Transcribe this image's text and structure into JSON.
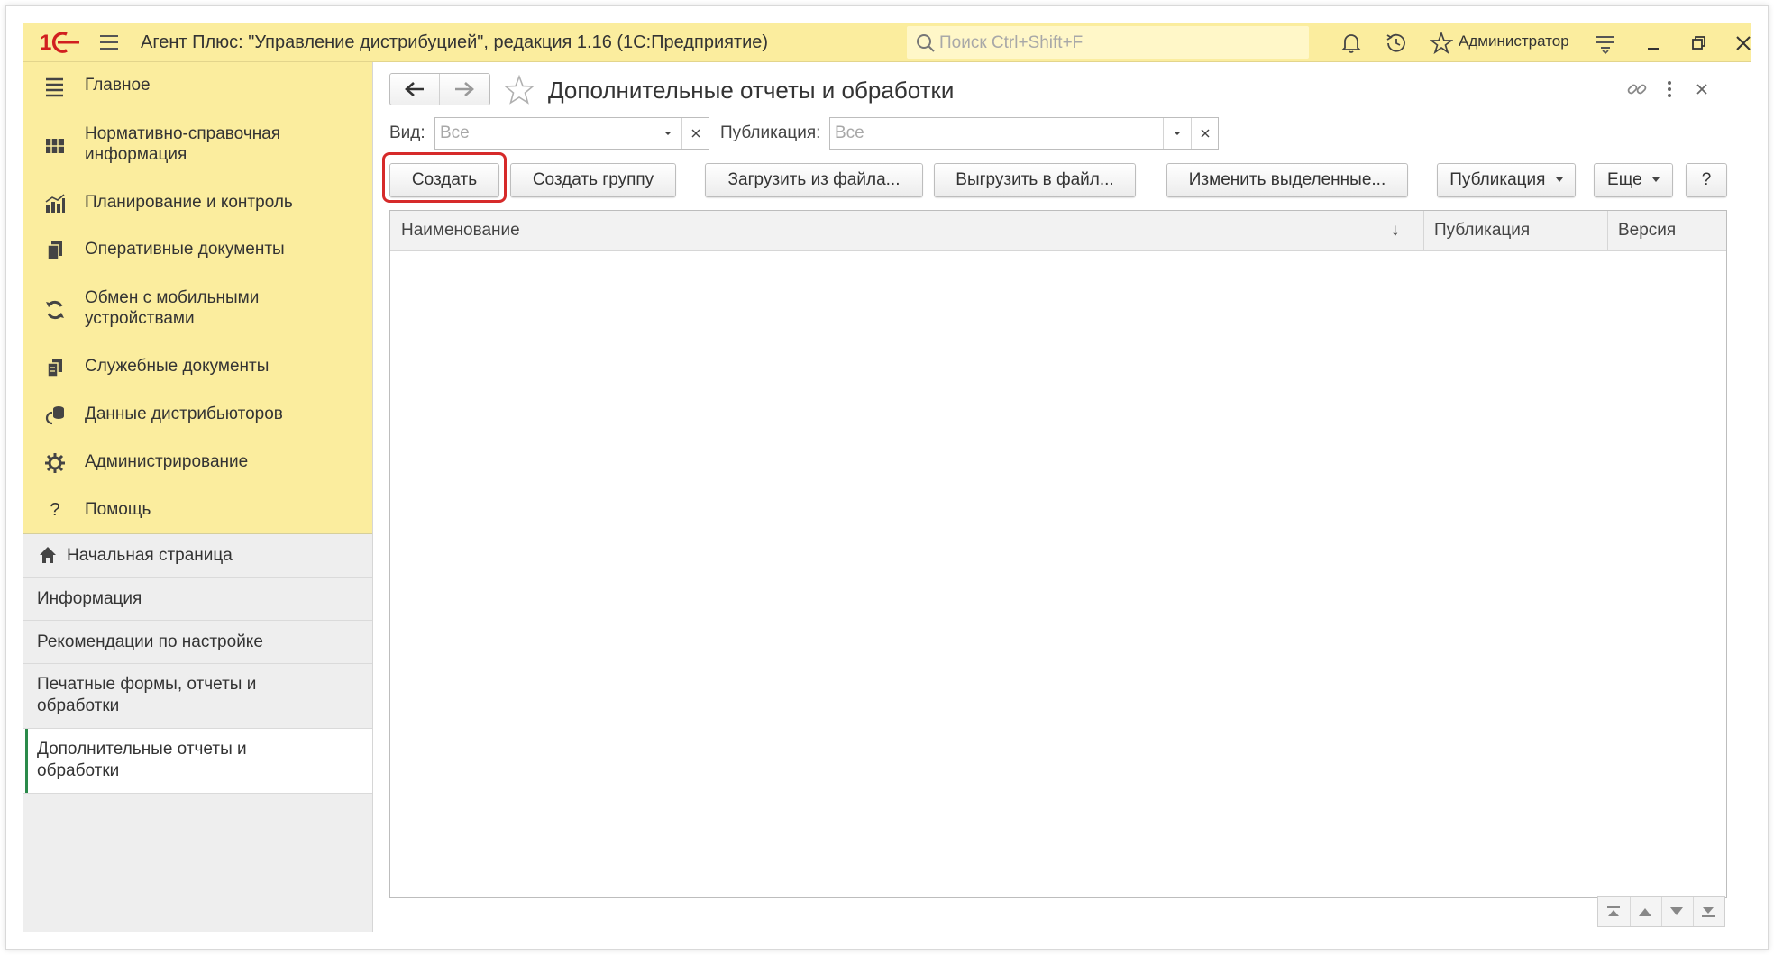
{
  "titlebar": {
    "logo_text": "1С",
    "app_title": "Агент Плюс: \"Управление дистрибуцией\", редакция 1.16  (1С:Предприятие)",
    "search_placeholder": "Поиск Ctrl+Shift+F",
    "username": "Администратор"
  },
  "sidebar": {
    "sections": [
      {
        "label": "Главное",
        "icon": "list-icon"
      },
      {
        "label": "Нормативно-справочная информация",
        "icon": "catalog-icon"
      },
      {
        "label": "Планирование и контроль",
        "icon": "chart-icon"
      },
      {
        "label": "Оперативные документы",
        "icon": "documents-icon"
      },
      {
        "label": "Обмен с мобильными устройствами",
        "icon": "sync-icon"
      },
      {
        "label": "Служебные документы",
        "icon": "service-documents-icon"
      },
      {
        "label": "Данные дистрибьюторов",
        "icon": "distributors-icon"
      },
      {
        "label": "Администрирование",
        "icon": "gear-icon"
      },
      {
        "label": "Помощь",
        "icon": "question-icon"
      }
    ],
    "nav": [
      {
        "label": "Начальная страница",
        "icon": "home-icon"
      },
      {
        "label": "Информация"
      },
      {
        "label": "Рекомендации по настройке"
      },
      {
        "label": "Печатные формы, отчеты и обработки"
      },
      {
        "label": "Дополнительные отчеты и обработки",
        "active": true
      }
    ]
  },
  "form": {
    "title": "Дополнительные отчеты и обработки",
    "filters": {
      "vid_label": "Вид:",
      "vid_value": "Все",
      "pub_label": "Публикация:",
      "pub_value": "Все"
    },
    "buttons": {
      "create": "Создать",
      "create_group": "Создать группу",
      "load": "Загрузить из файла...",
      "unload": "Выгрузить в файл...",
      "edit_selected": "Изменить выделенные...",
      "publication": "Публикация",
      "more": "Еще",
      "help": "?"
    },
    "table": {
      "columns": [
        "Наименование",
        "Публикация",
        "Версия"
      ],
      "sort_indicator": "↓",
      "rows": []
    }
  },
  "colors": {
    "accent_yellow": "#fbed9e",
    "highlight_red": "#d62a2a",
    "active_green": "#2a8a4a",
    "logo_red": "#d11f1f"
  }
}
